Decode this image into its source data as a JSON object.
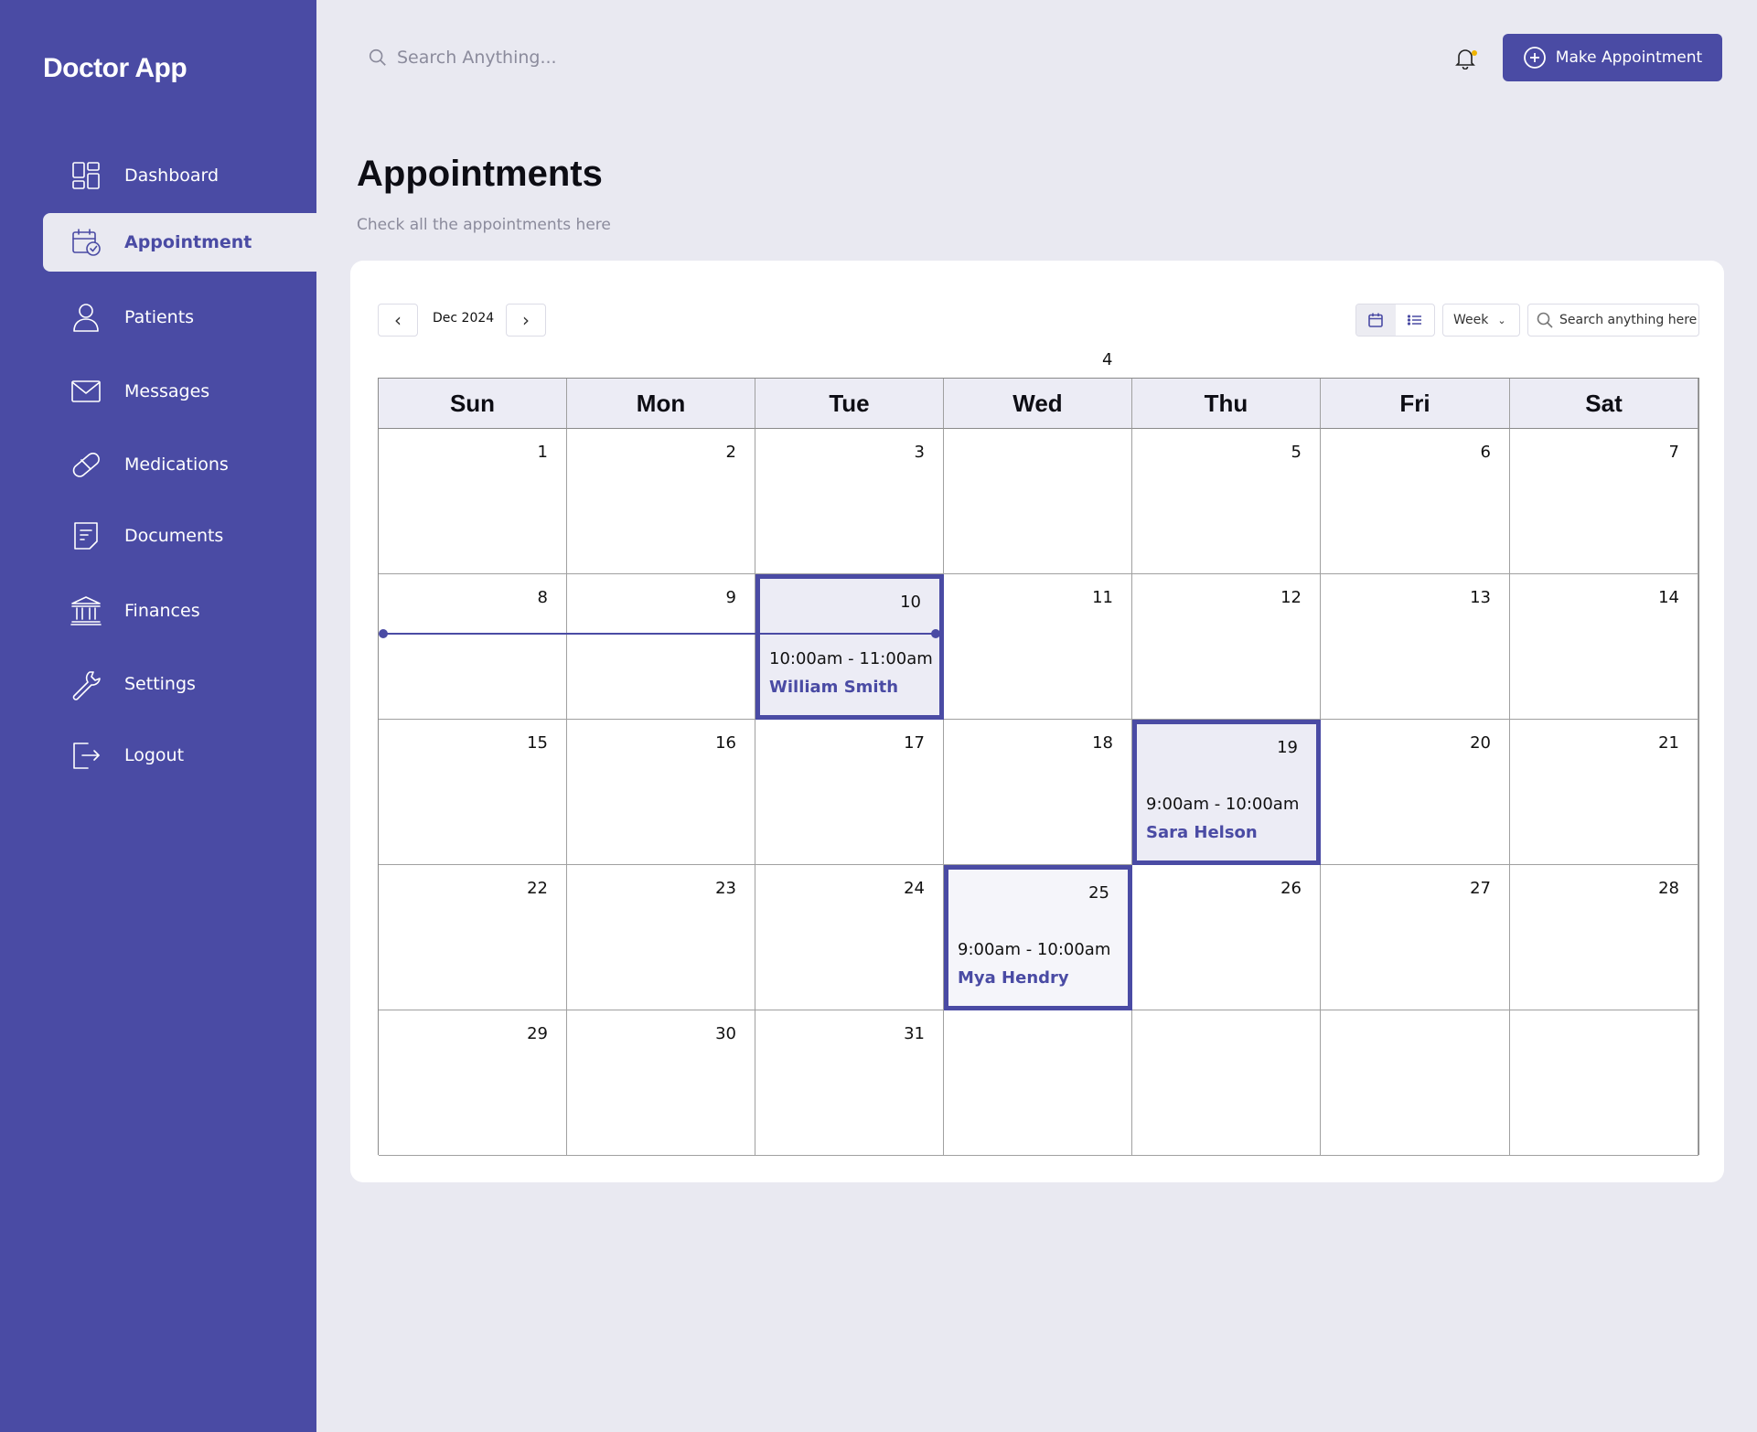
{
  "app": {
    "title": "Doctor App"
  },
  "sidebar": {
    "items": [
      {
        "label": "Dashboard",
        "icon": "dashboard-icon"
      },
      {
        "label": "Appointment",
        "icon": "calendar-check-icon"
      },
      {
        "label": "Patients",
        "icon": "user-icon"
      },
      {
        "label": "Messages",
        "icon": "mail-icon"
      },
      {
        "label": "Medications",
        "icon": "pill-icon"
      },
      {
        "label": "Documents",
        "icon": "document-icon"
      },
      {
        "label": "Finances",
        "icon": "bank-icon"
      },
      {
        "label": "Settings",
        "icon": "wrench-icon"
      },
      {
        "label": "Logout",
        "icon": "logout-icon"
      }
    ],
    "active": "Appointment"
  },
  "header": {
    "search_placeholder": "Search Anything...",
    "make_button": "Make Appointment"
  },
  "page": {
    "title": "Appointments",
    "subtitle": "Check all the appointments here"
  },
  "calendar": {
    "month_label": "Dec 2024",
    "prev": "‹",
    "next": "›",
    "view": "Week",
    "search_placeholder": "Search anything here",
    "week_number": "4",
    "weekdays": [
      "Sun",
      "Mon",
      "Tue",
      "Wed",
      "Thu",
      "Fri",
      "Sat"
    ],
    "weeks": [
      [
        "1",
        "2",
        "3",
        "",
        "5",
        "6",
        "7"
      ],
      [
        "8",
        "9",
        "10",
        "11",
        "12",
        "13",
        "14"
      ],
      [
        "15",
        "16",
        "17",
        "18",
        "19",
        "20",
        "21"
      ],
      [
        "22",
        "23",
        "24",
        "25",
        "26",
        "27",
        "28"
      ],
      [
        "29",
        "30",
        "31",
        "",
        "",
        "",
        ""
      ]
    ],
    "appointments": [
      {
        "day": "10",
        "time": "10:00am - 11:00am",
        "patient": "William Smith"
      },
      {
        "day": "19",
        "time": "9:00am - 10:00am",
        "patient": "Sara Helson"
      },
      {
        "day": "25",
        "time": "9:00am - 10:00am",
        "patient": "Mya Hendry"
      }
    ]
  },
  "colors": {
    "brand": "#4a4ba4",
    "background": "#e9e9f1",
    "highlight": "#ececf5"
  }
}
